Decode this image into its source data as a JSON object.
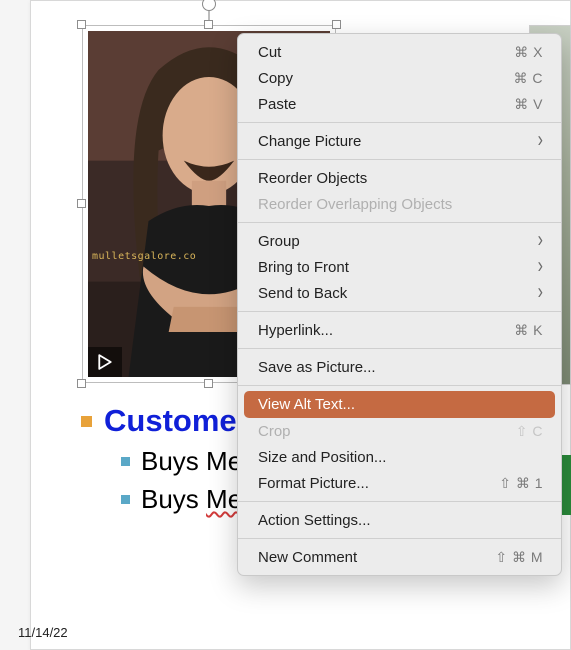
{
  "slide": {
    "watermark": "mulletsgalore.co",
    "heading": "Customer",
    "bullets": [
      {
        "prefix": "Buys ",
        "word": "Met"
      },
      {
        "prefix": "Buys ",
        "word": "Meg"
      }
    ],
    "date": "11/14/22"
  },
  "menu": {
    "items": [
      {
        "label": "Cut",
        "shortcut": "⌘ X"
      },
      {
        "label": "Copy",
        "shortcut": "⌘ C"
      },
      {
        "label": "Paste",
        "shortcut": "⌘ V"
      },
      {
        "sep": true
      },
      {
        "label": "Change Picture",
        "submenu": true
      },
      {
        "sep": true
      },
      {
        "label": "Reorder Objects"
      },
      {
        "label": "Reorder Overlapping Objects",
        "disabled": true
      },
      {
        "sep": true
      },
      {
        "label": "Group",
        "submenu": true
      },
      {
        "label": "Bring to Front",
        "submenu": true
      },
      {
        "label": "Send to Back",
        "submenu": true
      },
      {
        "sep": true
      },
      {
        "label": "Hyperlink...",
        "shortcut": "⌘ K"
      },
      {
        "sep": true
      },
      {
        "label": "Save as Picture..."
      },
      {
        "sep": true
      },
      {
        "label": "View Alt Text...",
        "highlight": true
      },
      {
        "label": "Crop",
        "shortcut": "⇧ C",
        "disabled": true
      },
      {
        "label": "Size and Position..."
      },
      {
        "label": "Format Picture...",
        "shortcut": "⇧ ⌘ 1"
      },
      {
        "sep": true
      },
      {
        "label": "Action Settings..."
      },
      {
        "sep": true
      },
      {
        "label": "New Comment",
        "shortcut": "⇧ ⌘ M"
      }
    ]
  }
}
